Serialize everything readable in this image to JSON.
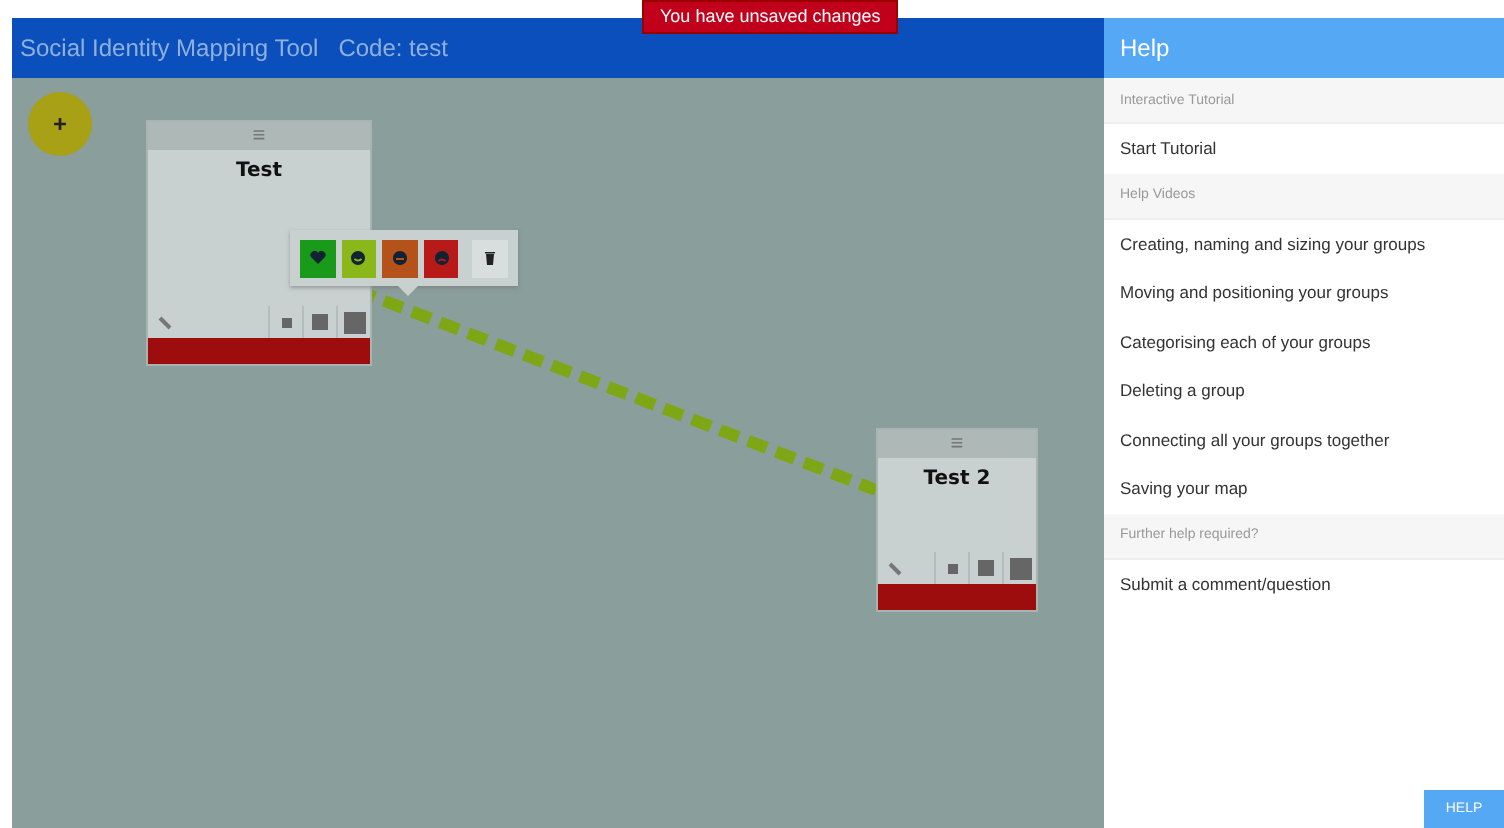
{
  "header": {
    "title": "Social Identity Mapping Tool",
    "code": "Code: test",
    "notice": "You have unsaved changes"
  },
  "canvas": {
    "add_button": "+",
    "groups": [
      {
        "name": "Test",
        "menu": "≡"
      },
      {
        "name": "Test 2",
        "menu": "≡"
      }
    ],
    "popup": [
      {
        "kind": "heart",
        "color": "#1a9a1a"
      },
      {
        "kind": "smile",
        "color": "#8ab81a"
      },
      {
        "kind": "neutral",
        "color": "#b5521a"
      },
      {
        "kind": "sad",
        "color": "#b81a1a"
      },
      {
        "kind": "delete"
      }
    ]
  },
  "help": {
    "title": "Help",
    "sections": [
      {
        "heading": "Interactive Tutorial",
        "items": [
          "Start Tutorial"
        ]
      },
      {
        "heading": "Help Videos",
        "items": [
          "Creating, naming and sizing your groups",
          "Moving and positioning your groups",
          "Categorising each of your groups",
          "Deleting a group",
          "Connecting all your groups together",
          "Saving your map"
        ]
      },
      {
        "heading": "Further help required?",
        "items": [
          "Submit a comment/question"
        ]
      }
    ],
    "button": "HELP"
  }
}
